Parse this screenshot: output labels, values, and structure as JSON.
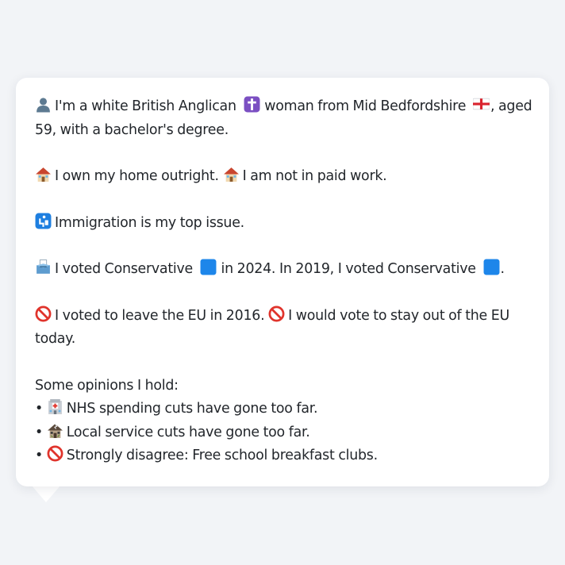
{
  "profile": {
    "identity": {
      "icon": "person-silhouette-icon",
      "text_before_religion": "I'm a white British Anglican",
      "religion_icon": "latin-cross-icon",
      "text_before_flag": "woman from Mid Bedfordshire",
      "flag_icon": "england-flag-icon",
      "text_after_flag": ", aged",
      "line2": "59, with a bachelor's degree."
    },
    "housing": {
      "icon": "house-icon",
      "text1": "I own my home outright.",
      "icon2": "house-icon",
      "text2": "I am not in paid work."
    },
    "issue": {
      "icon": "passport-control-icon",
      "text": "Immigration is my top issue."
    },
    "vote": {
      "icon": "ballot-box-icon",
      "text_before_party1": "I voted Conservative",
      "party_icon_1": "blue-square-icon",
      "text_middle": "in 2024. In 2019, I voted Conservative",
      "party_icon_2": "blue-square-icon",
      "text_end": "."
    },
    "eu": {
      "icon": "prohibited-icon",
      "text1": "I voted to leave the EU in 2016.",
      "icon2": "prohibited-icon",
      "text2_line1": "I would vote to stay out of the EU",
      "text2_line2": "today."
    },
    "opinions": {
      "heading": "Some opinions I hold:",
      "bullet": "•",
      "items": [
        {
          "icon": "hospital-icon",
          "text": "NHS spending cuts have gone too far."
        },
        {
          "icon": "derelict-house-icon",
          "text": "Local service cuts have gone too far."
        },
        {
          "icon": "prohibited-icon",
          "text": "Strongly disagree: Free school breakfast clubs."
        }
      ]
    }
  },
  "colors": {
    "page_background": "#f2f4f7",
    "card_background": "#ffffff",
    "text": "#22262b",
    "conservative_blue": "#1d86ea",
    "prohibited_red": "#e0342c",
    "cross_purple": "#7b4fc2",
    "passport_blue": "#1e7fe0"
  }
}
